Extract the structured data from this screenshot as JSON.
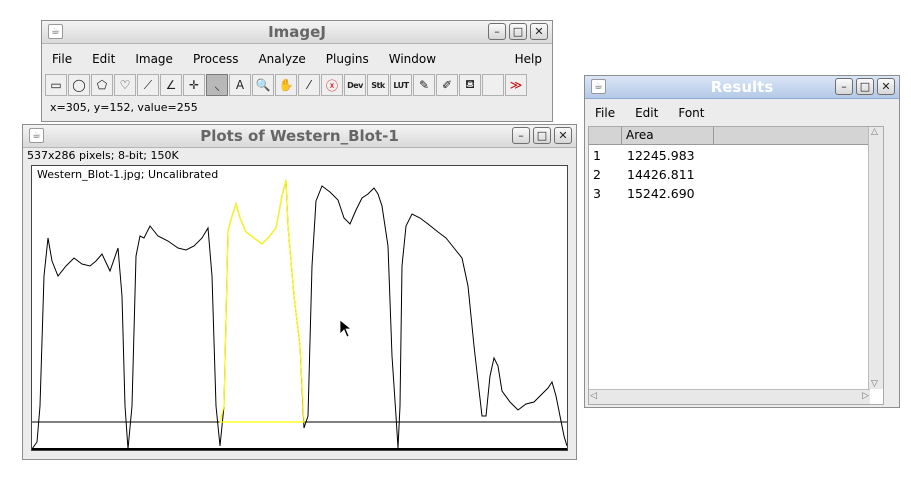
{
  "imagej": {
    "title": "ImageJ",
    "menu": [
      "File",
      "Edit",
      "Image",
      "Process",
      "Analyze",
      "Plugins",
      "Window",
      "Help"
    ],
    "tools": [
      {
        "icon": "rectangle-tool-icon",
        "glyph": "▭",
        "selected": false
      },
      {
        "icon": "oval-tool-icon",
        "glyph": "◯",
        "selected": false
      },
      {
        "icon": "polygon-tool-icon",
        "glyph": "⬠",
        "selected": false
      },
      {
        "icon": "freehand-tool-icon",
        "glyph": "♡",
        "selected": false
      },
      {
        "icon": "line-tool-icon",
        "glyph": "⟋",
        "selected": false
      },
      {
        "icon": "angle-tool-icon",
        "glyph": "∠",
        "selected": false
      },
      {
        "icon": "point-tool-icon",
        "glyph": "✛",
        "selected": false
      },
      {
        "icon": "wand-tool-icon",
        "glyph": "⸜",
        "selected": true
      },
      {
        "icon": "text-tool-icon",
        "glyph": "A",
        "selected": false
      },
      {
        "icon": "magnifier-tool-icon",
        "glyph": "🔍",
        "selected": false
      },
      {
        "icon": "hand-tool-icon",
        "glyph": "✋",
        "selected": false
      },
      {
        "icon": "dropper-tool-icon",
        "glyph": "⁄",
        "selected": false
      },
      {
        "icon": "close-x-tool-icon",
        "glyph": "ⓧ",
        "selected": false
      },
      {
        "icon": "dev-tool-icon",
        "glyph": "Dev",
        "selected": false
      },
      {
        "icon": "stk-tool-icon",
        "glyph": "Stk",
        "selected": false
      },
      {
        "icon": "lut-tool-icon",
        "glyph": "LUT",
        "selected": false
      },
      {
        "icon": "pencil-tool-icon",
        "glyph": "✎",
        "selected": false
      },
      {
        "icon": "brush-tool-icon",
        "glyph": "✐",
        "selected": false
      },
      {
        "icon": "flood-fill-tool-icon",
        "glyph": "⛾",
        "selected": false
      },
      {
        "icon": "blank-tool-icon",
        "glyph": "",
        "selected": false
      },
      {
        "icon": "more-tools-icon",
        "glyph": "≫",
        "selected": false
      }
    ],
    "status": "x=305, y=152, value=255"
  },
  "plot": {
    "title": "Plots of Western_Blot-1",
    "info": "537x286 pixels; 8-bit; 150K",
    "label": "Western_Blot-1.jpg; Uncalibrated"
  },
  "results": {
    "title": "Results",
    "menu": [
      "File",
      "Edit",
      "Font"
    ],
    "column": "Area",
    "rows": [
      {
        "n": "1",
        "area": "12245.983"
      },
      {
        "n": "2",
        "area": "14426.811"
      },
      {
        "n": "3",
        "area": "15242.690"
      }
    ]
  },
  "window_buttons": {
    "minimize": "–",
    "maximize": "□",
    "close": "✕"
  },
  "colors": {
    "profile": "#000000",
    "selection": "#ffff00",
    "title_active": "#b3c9e8"
  }
}
